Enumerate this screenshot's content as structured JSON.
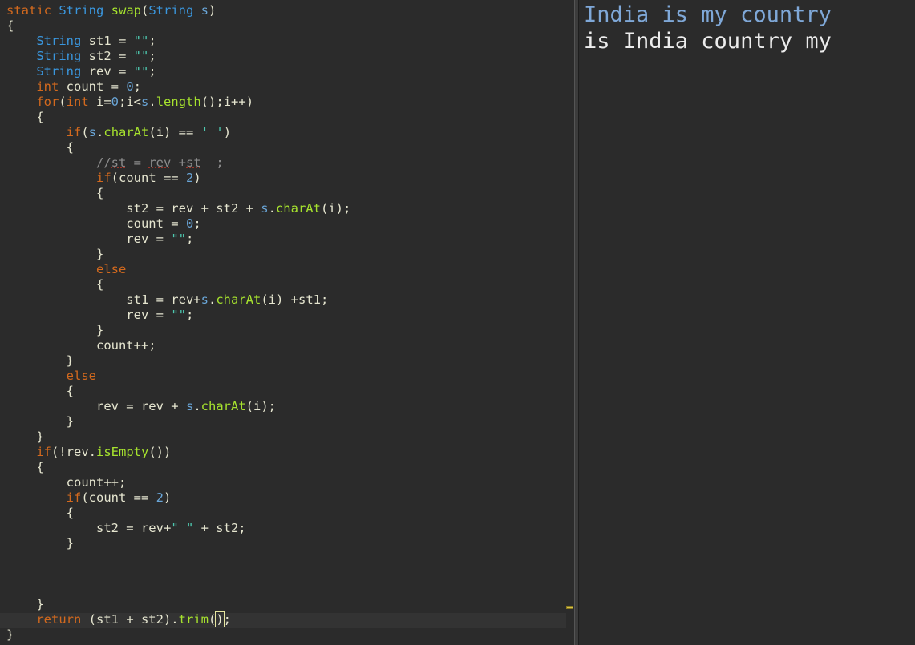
{
  "editor": {
    "lines": [
      [
        [
          "kw",
          "static "
        ],
        [
          "ty",
          "String "
        ],
        [
          "fn",
          "swap"
        ],
        [
          "id",
          "("
        ],
        [
          "ty",
          "String "
        ],
        [
          "num",
          "s"
        ],
        [
          "id",
          ")"
        ]
      ],
      [
        [
          "id",
          "{"
        ]
      ],
      [
        [
          "id",
          "    "
        ],
        [
          "ty",
          "String "
        ],
        [
          "id",
          "st1 = "
        ],
        [
          "str",
          "\"\""
        ],
        [
          "id",
          ";"
        ]
      ],
      [
        [
          "id",
          "    "
        ],
        [
          "ty",
          "String "
        ],
        [
          "id",
          "st2 = "
        ],
        [
          "str",
          "\"\""
        ],
        [
          "id",
          ";"
        ]
      ],
      [
        [
          "id",
          "    "
        ],
        [
          "ty",
          "String "
        ],
        [
          "id",
          "rev = "
        ],
        [
          "str",
          "\"\""
        ],
        [
          "id",
          ";"
        ]
      ],
      [
        [
          "id",
          "    "
        ],
        [
          "kw",
          "int "
        ],
        [
          "id",
          "count = "
        ],
        [
          "num",
          "0"
        ],
        [
          "id",
          ";"
        ]
      ],
      [
        [
          "id",
          "    "
        ],
        [
          "kw",
          "for"
        ],
        [
          "id",
          "("
        ],
        [
          "kw",
          "int "
        ],
        [
          "id",
          "i="
        ],
        [
          "num",
          "0"
        ],
        [
          "id",
          ";i<"
        ],
        [
          "num",
          "s"
        ],
        [
          "id",
          "."
        ],
        [
          "fn",
          "length"
        ],
        [
          "id",
          "();i++)"
        ]
      ],
      [
        [
          "id",
          "    {"
        ]
      ],
      [
        [
          "id",
          "        "
        ],
        [
          "kw",
          "if"
        ],
        [
          "id",
          "("
        ],
        [
          "num",
          "s"
        ],
        [
          "id",
          "."
        ],
        [
          "fn",
          "charAt"
        ],
        [
          "id",
          "(i) == "
        ],
        [
          "str",
          "' '"
        ],
        [
          "id",
          ")"
        ]
      ],
      [
        [
          "id",
          "        {"
        ]
      ],
      [
        [
          "id",
          "            "
        ],
        [
          "cm",
          "//"
        ],
        [
          "cmsq",
          "st"
        ],
        [
          "cm",
          " = "
        ],
        [
          "cmsq",
          "rev"
        ],
        [
          "cm",
          " +"
        ],
        [
          "cmsq",
          "st"
        ],
        [
          "cm",
          "  ;"
        ]
      ],
      [
        [
          "id",
          "            "
        ],
        [
          "kw",
          "if"
        ],
        [
          "id",
          "(count == "
        ],
        [
          "num",
          "2"
        ],
        [
          "id",
          ")"
        ]
      ],
      [
        [
          "id",
          "            {"
        ]
      ],
      [
        [
          "id",
          "                st2 = rev + st2 + "
        ],
        [
          "num",
          "s"
        ],
        [
          "id",
          "."
        ],
        [
          "fn",
          "charAt"
        ],
        [
          "id",
          "(i);"
        ]
      ],
      [
        [
          "id",
          "                count = "
        ],
        [
          "num",
          "0"
        ],
        [
          "id",
          ";"
        ]
      ],
      [
        [
          "id",
          "                rev = "
        ],
        [
          "str",
          "\"\""
        ],
        [
          "id",
          ";"
        ]
      ],
      [
        [
          "id",
          "            }"
        ]
      ],
      [
        [
          "id",
          "            "
        ],
        [
          "kw",
          "else"
        ]
      ],
      [
        [
          "id",
          "            {"
        ]
      ],
      [
        [
          "id",
          "                st1 = rev+"
        ],
        [
          "num",
          "s"
        ],
        [
          "id",
          "."
        ],
        [
          "fn",
          "charAt"
        ],
        [
          "id",
          "(i) +st1;"
        ]
      ],
      [
        [
          "id",
          "                rev = "
        ],
        [
          "str",
          "\"\""
        ],
        [
          "id",
          ";"
        ]
      ],
      [
        [
          "id",
          "            }"
        ]
      ],
      [
        [
          "id",
          "            count++;"
        ]
      ],
      [
        [
          "id",
          "        }"
        ]
      ],
      [
        [
          "id",
          "        "
        ],
        [
          "kw",
          "else"
        ]
      ],
      [
        [
          "id",
          "        {"
        ]
      ],
      [
        [
          "id",
          "            rev = rev + "
        ],
        [
          "num",
          "s"
        ],
        [
          "id",
          "."
        ],
        [
          "fn",
          "charAt"
        ],
        [
          "id",
          "(i);"
        ]
      ],
      [
        [
          "id",
          "        }"
        ]
      ],
      [
        [
          "id",
          "    }"
        ]
      ],
      [
        [
          "id",
          "    "
        ],
        [
          "kw",
          "if"
        ],
        [
          "id",
          "(!rev."
        ],
        [
          "fn",
          "isEmpty"
        ],
        [
          "id",
          "())"
        ]
      ],
      [
        [
          "id",
          "    {"
        ]
      ],
      [
        [
          "id",
          "        count++;"
        ]
      ],
      [
        [
          "id",
          "        "
        ],
        [
          "kw",
          "if"
        ],
        [
          "id",
          "(count == "
        ],
        [
          "num",
          "2"
        ],
        [
          "id",
          ")"
        ]
      ],
      [
        [
          "id",
          "        {"
        ]
      ],
      [
        [
          "id",
          "            st2 = rev+"
        ],
        [
          "str",
          "\" \""
        ],
        [
          "id",
          " + st2;"
        ]
      ],
      [
        [
          "id",
          "        }"
        ]
      ],
      [
        [
          "id",
          ""
        ]
      ],
      [
        [
          "id",
          ""
        ]
      ],
      [
        [
          "id",
          ""
        ]
      ],
      [
        [
          "id",
          "    }"
        ]
      ],
      [
        [
          "id",
          "    "
        ],
        [
          "kw",
          "return "
        ],
        [
          "id",
          "(st1 + st2)."
        ],
        [
          "fn",
          "trim"
        ],
        [
          "id",
          "("
        ],
        [
          "cur",
          ")"
        ],
        [
          "id",
          ";"
        ]
      ],
      [
        [
          "id",
          "}"
        ]
      ]
    ]
  },
  "output": {
    "input_line": "India is my country",
    "result_line": "is India country my"
  },
  "colors": {
    "background": "#2b2b2b",
    "keyword": "#d2691e",
    "type": "#3a96dd",
    "method": "#a6e22e",
    "string": "#4ec9b0",
    "output_input": "#7fa8d8"
  }
}
